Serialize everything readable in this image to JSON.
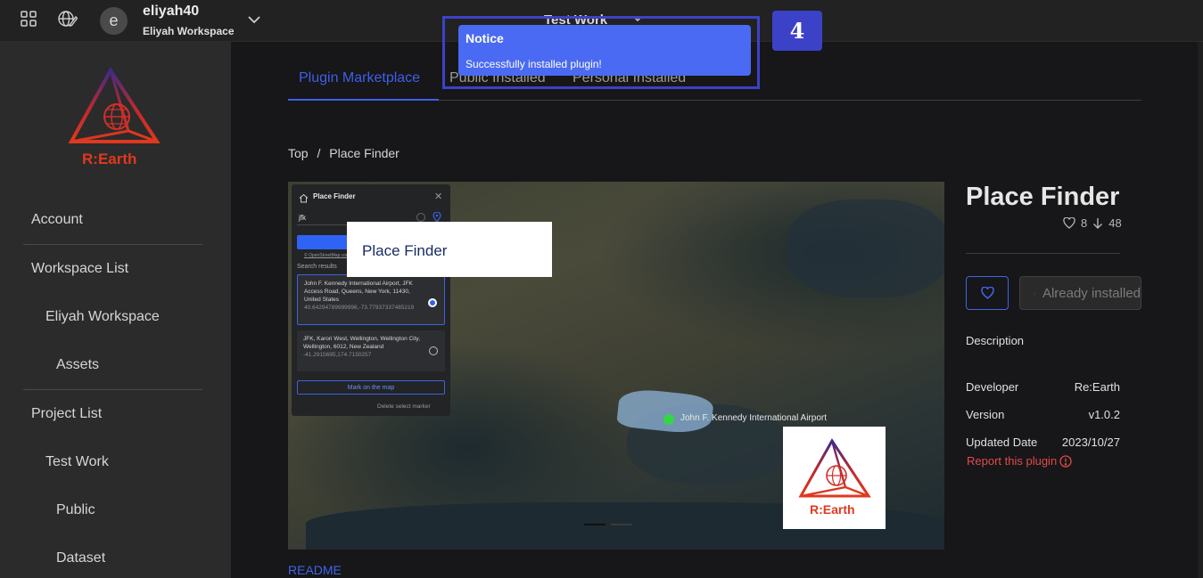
{
  "header": {
    "user_name": "eliyah40",
    "workspace_name": "Eliyah Workspace",
    "avatar_letter": "e",
    "project_title": "Test Work"
  },
  "sidebar": {
    "logo_text": "R:Earth",
    "items": [
      {
        "label": "Account"
      },
      {
        "label": "Workspace List"
      },
      {
        "label": "Eliyah Workspace"
      },
      {
        "label": "Assets"
      },
      {
        "label": "Project List"
      },
      {
        "label": "Test Work"
      },
      {
        "label": "Public"
      },
      {
        "label": "Dataset"
      }
    ]
  },
  "tabs": [
    {
      "label": "Plugin Marketplace",
      "active": true
    },
    {
      "label": "Public Installed",
      "active": false
    },
    {
      "label": "Personal Installed",
      "active": false
    }
  ],
  "breadcrumb": {
    "root": "Top",
    "separator": "/",
    "current": "Place Finder"
  },
  "hero": {
    "overlay_label": "Place Finder",
    "logo_text": "R:Earth",
    "airport_label": "John F. Kennedy International Airport",
    "panel": {
      "title": "Place Finder",
      "query": "jfk",
      "attribution": "© OpenStreetMap contributors",
      "results_label": "Search results",
      "results": [
        {
          "text": "John F. Kennedy International Airport, JFK Access Road, Queens, New York, 11430, United States",
          "coords": "40.64294789999996,-73.77937337485219",
          "selected": true
        },
        {
          "text": "JFK, Karori West, Wellington, Wellington City, Wellington, 6012, New Zealand",
          "coords": "-41.2915695,174.7150257",
          "selected": false
        }
      ],
      "mark_button": "Mark on the map",
      "delete_label": "Delete select marker"
    }
  },
  "readme_link": "README",
  "detail": {
    "title": "Place Finder",
    "likes": "8",
    "downloads": "48",
    "installed_label": "Already installed",
    "description_label": "Description",
    "meta": [
      {
        "key": "Developer",
        "value": "Re:Earth"
      },
      {
        "key": "Version",
        "value": "v1.0.2"
      },
      {
        "key": "Updated Date",
        "value": "2023/10/27"
      }
    ],
    "report_label": "Report this plugin"
  },
  "notice": {
    "title": "Notice",
    "message": "Successfully installed plugin!",
    "step": "4"
  },
  "colors": {
    "accent": "#3e5fe9",
    "notice_bg": "#4a6af3",
    "highlight_frame": "#3c42c8",
    "danger": "#e04b4b",
    "logo_red": "#e0391f",
    "logo_purple": "#3e2a8c"
  }
}
